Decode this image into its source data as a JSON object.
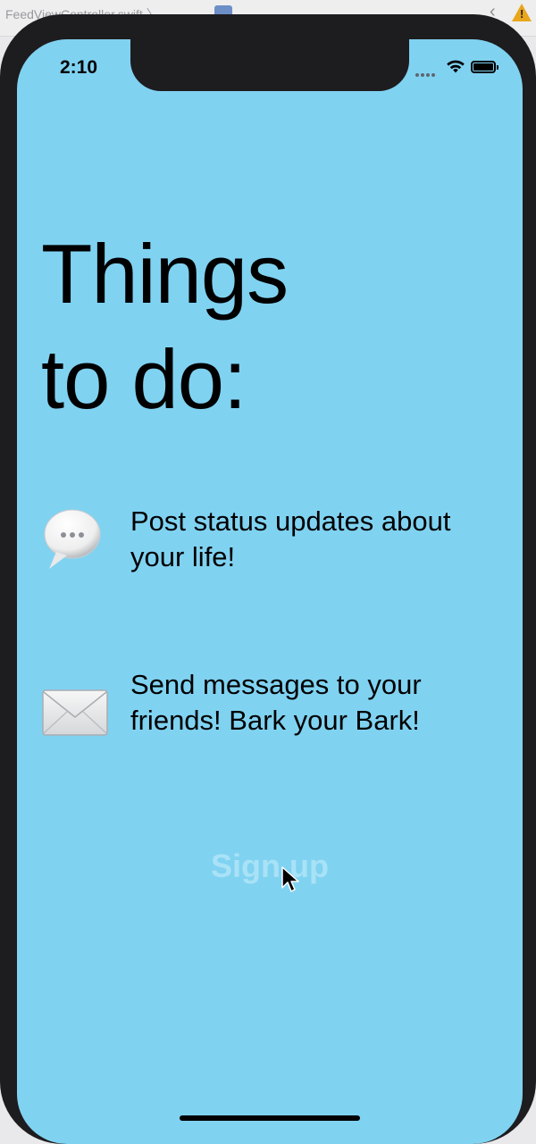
{
  "xcode": {
    "path_text": "FeedViewController.swift  〉",
    "chevron": "‹"
  },
  "status_bar": {
    "time": "2:10"
  },
  "title": {
    "line1": "Things",
    "line2": "to do:"
  },
  "features": [
    {
      "icon": "speech-bubble-icon",
      "text": "Post status updates about your life!"
    },
    {
      "icon": "envelope-icon",
      "text": "Send messages to your friends! Bark your Bark!"
    }
  ],
  "signup_label": "Sign up",
  "colors": {
    "background": "#80d2f1",
    "signup_text": "#a9e2f6",
    "device_frame": "#1d1c1f"
  }
}
